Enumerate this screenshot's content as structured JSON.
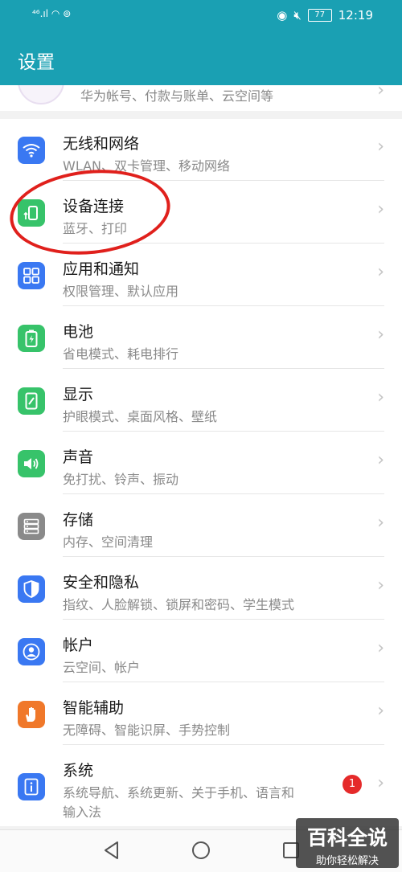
{
  "status": {
    "left_text": "⁴⁶.ıl  ◠  ⊚",
    "battery": "77",
    "time": "12:19"
  },
  "header": {
    "title": "设置"
  },
  "account": {
    "subtitle": "华为帐号、付款与账单、云空间等"
  },
  "items": [
    {
      "title": "无线和网络",
      "subtitle": "WLAN、双卡管理、移动网络",
      "icon": "wifi-icon",
      "color": "#3a78f2"
    },
    {
      "title": "设备连接",
      "subtitle": "蓝牙、打印",
      "icon": "device-connection-icon",
      "color": "#37c36a"
    },
    {
      "title": "应用和通知",
      "subtitle": "权限管理、默认应用",
      "icon": "apps-grid-icon",
      "color": "#3a78f2"
    },
    {
      "title": "电池",
      "subtitle": "省电模式、耗电排行",
      "icon": "battery-icon",
      "color": "#37c36a"
    },
    {
      "title": "显示",
      "subtitle": "护眼模式、桌面风格、壁纸",
      "icon": "display-icon",
      "color": "#37c36a"
    },
    {
      "title": "声音",
      "subtitle": "免打扰、铃声、振动",
      "icon": "sound-icon",
      "color": "#37c36a"
    },
    {
      "title": "存储",
      "subtitle": "内存、空间清理",
      "icon": "storage-icon",
      "color": "#8a8a8a"
    },
    {
      "title": "安全和隐私",
      "subtitle": "指纹、人脸解锁、锁屏和密码、学生模式",
      "icon": "shield-icon",
      "color": "#3a78f2"
    },
    {
      "title": "帐户",
      "subtitle": "云空间、帐户",
      "icon": "account-icon",
      "color": "#3a78f2"
    },
    {
      "title": "智能辅助",
      "subtitle": "无障碍、智能识屏、手势控制",
      "icon": "hand-icon",
      "color": "#f0782a"
    },
    {
      "title": "系统",
      "subtitle": "系统导航、系统更新、关于手机、语言和",
      "subtitle2": "输入法",
      "icon": "system-info-icon",
      "color": "#3a78f2",
      "badge": "1"
    }
  ],
  "chevron": "›",
  "watermark": {
    "title": "百科全说",
    "subtitle": "助你轻松解决"
  }
}
